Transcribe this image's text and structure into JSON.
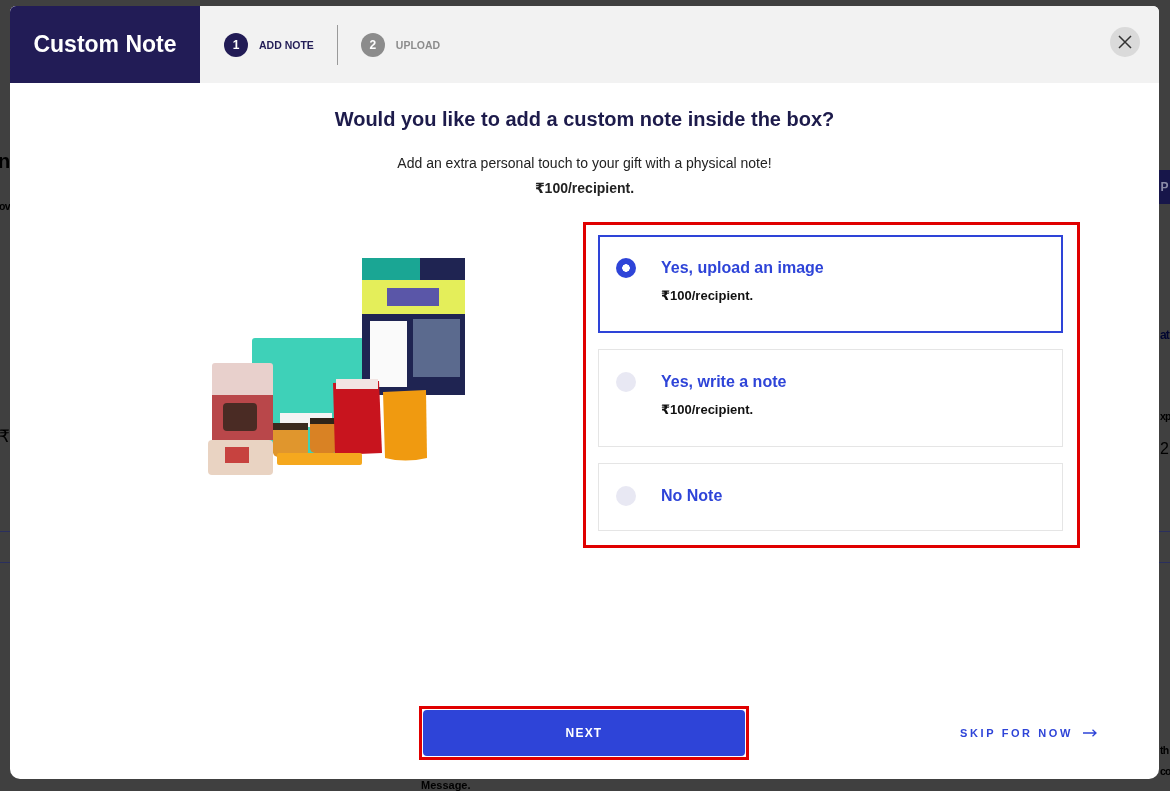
{
  "background_page": {
    "left_edge_texts": [
      "n",
      "ov",
      "₹"
    ],
    "right_edge_texts": [
      {
        "kind": "button",
        "text": "P"
      },
      {
        "kind": "link",
        "text": "at"
      },
      {
        "kind": "label",
        "text": "xp"
      },
      {
        "kind": "value",
        "text": "2"
      },
      {
        "kind": "text",
        "text": "th"
      },
      {
        "kind": "text",
        "text": "co"
      }
    ],
    "bottom_text": "Message."
  },
  "modal": {
    "title": "Custom Note",
    "steps": [
      {
        "number": "1",
        "label": "ADD NOTE",
        "selected": true
      },
      {
        "number": "2",
        "label": "UPLOAD",
        "selected": false
      }
    ],
    "heading": "Would you like to add a custom note inside the box?",
    "subtitle": "Add an extra personal touch to your gift with a physical note!",
    "price": "₹100/recipient.",
    "options": {
      "highlighted": true,
      "items": [
        {
          "title": "Yes, upload an image",
          "price": "₹100/recipient.",
          "selected": true
        },
        {
          "title": "Yes, write a note",
          "price": "₹100/recipient.",
          "selected": false
        },
        {
          "title": "No Note",
          "selected": false
        }
      ]
    },
    "next_button": {
      "label": "NEXT",
      "highlighted": true
    },
    "skip_link": "SKIP FOR NOW"
  }
}
